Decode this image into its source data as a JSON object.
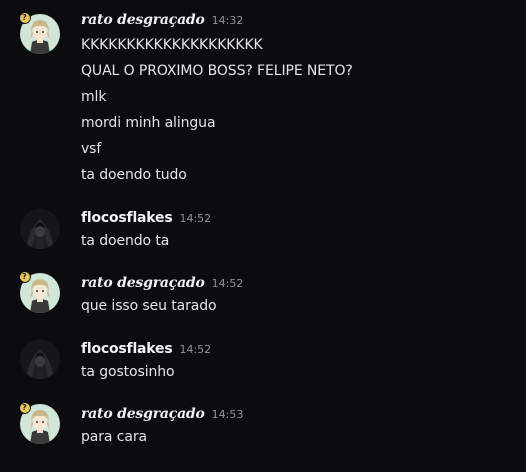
{
  "messages": [
    {
      "author": "rato desgraçado",
      "time": "14:32",
      "lines": [
        "KKKKKKKKKKKKKKKKKKKK",
        "QUAL O PROXIMO BOSS? FELIPE NETO?",
        "mlk",
        "mordi minh alingua",
        "vsf",
        "ta doendo tudo"
      ]
    },
    {
      "author": "flocosflakes",
      "time": "14:52",
      "lines": [
        "ta doendo ta"
      ]
    },
    {
      "author": "rato desgraçado",
      "time": "14:52",
      "lines": [
        "que isso seu tarado"
      ]
    },
    {
      "author": "flocosflakes",
      "time": "14:52",
      "lines": [
        "ta gostosinho"
      ]
    },
    {
      "author": "rato desgraçado",
      "time": "14:53",
      "lines": [
        "para cara"
      ]
    }
  ],
  "badge_glyph": "?",
  "avatars": {
    "rato": {
      "icon": "anime-character-avatar",
      "bg": "#cfe6d9"
    },
    "flocos": {
      "icon": "dark-hooded-avatar",
      "bg": "#15151a"
    }
  }
}
